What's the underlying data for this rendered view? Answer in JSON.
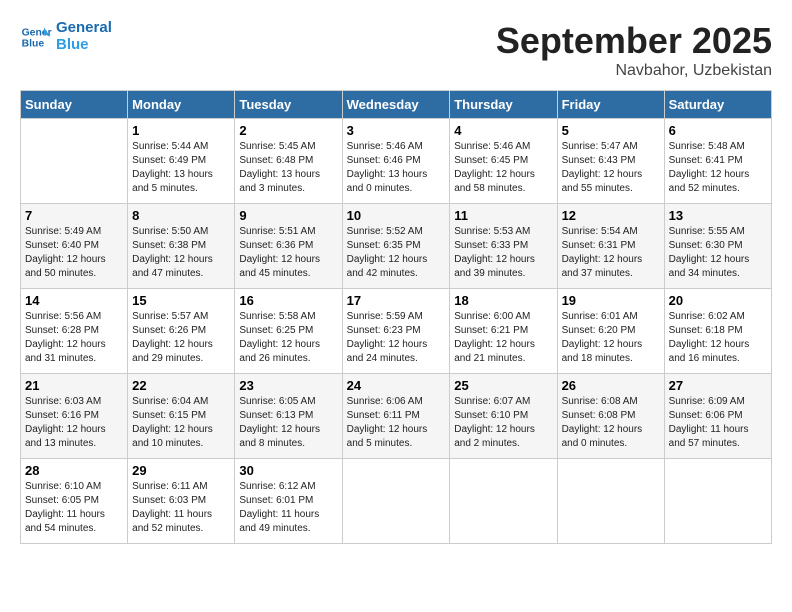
{
  "header": {
    "logo_line1": "General",
    "logo_line2": "Blue",
    "month": "September 2025",
    "location": "Navbahor, Uzbekistan"
  },
  "days_of_week": [
    "Sunday",
    "Monday",
    "Tuesday",
    "Wednesday",
    "Thursday",
    "Friday",
    "Saturday"
  ],
  "weeks": [
    [
      {
        "day": "",
        "sunrise": "",
        "sunset": "",
        "daylight": ""
      },
      {
        "day": "1",
        "sunrise": "Sunrise: 5:44 AM",
        "sunset": "Sunset: 6:49 PM",
        "daylight": "Daylight: 13 hours and 5 minutes."
      },
      {
        "day": "2",
        "sunrise": "Sunrise: 5:45 AM",
        "sunset": "Sunset: 6:48 PM",
        "daylight": "Daylight: 13 hours and 3 minutes."
      },
      {
        "day": "3",
        "sunrise": "Sunrise: 5:46 AM",
        "sunset": "Sunset: 6:46 PM",
        "daylight": "Daylight: 13 hours and 0 minutes."
      },
      {
        "day": "4",
        "sunrise": "Sunrise: 5:46 AM",
        "sunset": "Sunset: 6:45 PM",
        "daylight": "Daylight: 12 hours and 58 minutes."
      },
      {
        "day": "5",
        "sunrise": "Sunrise: 5:47 AM",
        "sunset": "Sunset: 6:43 PM",
        "daylight": "Daylight: 12 hours and 55 minutes."
      },
      {
        "day": "6",
        "sunrise": "Sunrise: 5:48 AM",
        "sunset": "Sunset: 6:41 PM",
        "daylight": "Daylight: 12 hours and 52 minutes."
      }
    ],
    [
      {
        "day": "7",
        "sunrise": "Sunrise: 5:49 AM",
        "sunset": "Sunset: 6:40 PM",
        "daylight": "Daylight: 12 hours and 50 minutes."
      },
      {
        "day": "8",
        "sunrise": "Sunrise: 5:50 AM",
        "sunset": "Sunset: 6:38 PM",
        "daylight": "Daylight: 12 hours and 47 minutes."
      },
      {
        "day": "9",
        "sunrise": "Sunrise: 5:51 AM",
        "sunset": "Sunset: 6:36 PM",
        "daylight": "Daylight: 12 hours and 45 minutes."
      },
      {
        "day": "10",
        "sunrise": "Sunrise: 5:52 AM",
        "sunset": "Sunset: 6:35 PM",
        "daylight": "Daylight: 12 hours and 42 minutes."
      },
      {
        "day": "11",
        "sunrise": "Sunrise: 5:53 AM",
        "sunset": "Sunset: 6:33 PM",
        "daylight": "Daylight: 12 hours and 39 minutes."
      },
      {
        "day": "12",
        "sunrise": "Sunrise: 5:54 AM",
        "sunset": "Sunset: 6:31 PM",
        "daylight": "Daylight: 12 hours and 37 minutes."
      },
      {
        "day": "13",
        "sunrise": "Sunrise: 5:55 AM",
        "sunset": "Sunset: 6:30 PM",
        "daylight": "Daylight: 12 hours and 34 minutes."
      }
    ],
    [
      {
        "day": "14",
        "sunrise": "Sunrise: 5:56 AM",
        "sunset": "Sunset: 6:28 PM",
        "daylight": "Daylight: 12 hours and 31 minutes."
      },
      {
        "day": "15",
        "sunrise": "Sunrise: 5:57 AM",
        "sunset": "Sunset: 6:26 PM",
        "daylight": "Daylight: 12 hours and 29 minutes."
      },
      {
        "day": "16",
        "sunrise": "Sunrise: 5:58 AM",
        "sunset": "Sunset: 6:25 PM",
        "daylight": "Daylight: 12 hours and 26 minutes."
      },
      {
        "day": "17",
        "sunrise": "Sunrise: 5:59 AM",
        "sunset": "Sunset: 6:23 PM",
        "daylight": "Daylight: 12 hours and 24 minutes."
      },
      {
        "day": "18",
        "sunrise": "Sunrise: 6:00 AM",
        "sunset": "Sunset: 6:21 PM",
        "daylight": "Daylight: 12 hours and 21 minutes."
      },
      {
        "day": "19",
        "sunrise": "Sunrise: 6:01 AM",
        "sunset": "Sunset: 6:20 PM",
        "daylight": "Daylight: 12 hours and 18 minutes."
      },
      {
        "day": "20",
        "sunrise": "Sunrise: 6:02 AM",
        "sunset": "Sunset: 6:18 PM",
        "daylight": "Daylight: 12 hours and 16 minutes."
      }
    ],
    [
      {
        "day": "21",
        "sunrise": "Sunrise: 6:03 AM",
        "sunset": "Sunset: 6:16 PM",
        "daylight": "Daylight: 12 hours and 13 minutes."
      },
      {
        "day": "22",
        "sunrise": "Sunrise: 6:04 AM",
        "sunset": "Sunset: 6:15 PM",
        "daylight": "Daylight: 12 hours and 10 minutes."
      },
      {
        "day": "23",
        "sunrise": "Sunrise: 6:05 AM",
        "sunset": "Sunset: 6:13 PM",
        "daylight": "Daylight: 12 hours and 8 minutes."
      },
      {
        "day": "24",
        "sunrise": "Sunrise: 6:06 AM",
        "sunset": "Sunset: 6:11 PM",
        "daylight": "Daylight: 12 hours and 5 minutes."
      },
      {
        "day": "25",
        "sunrise": "Sunrise: 6:07 AM",
        "sunset": "Sunset: 6:10 PM",
        "daylight": "Daylight: 12 hours and 2 minutes."
      },
      {
        "day": "26",
        "sunrise": "Sunrise: 6:08 AM",
        "sunset": "Sunset: 6:08 PM",
        "daylight": "Daylight: 12 hours and 0 minutes."
      },
      {
        "day": "27",
        "sunrise": "Sunrise: 6:09 AM",
        "sunset": "Sunset: 6:06 PM",
        "daylight": "Daylight: 11 hours and 57 minutes."
      }
    ],
    [
      {
        "day": "28",
        "sunrise": "Sunrise: 6:10 AM",
        "sunset": "Sunset: 6:05 PM",
        "daylight": "Daylight: 11 hours and 54 minutes."
      },
      {
        "day": "29",
        "sunrise": "Sunrise: 6:11 AM",
        "sunset": "Sunset: 6:03 PM",
        "daylight": "Daylight: 11 hours and 52 minutes."
      },
      {
        "day": "30",
        "sunrise": "Sunrise: 6:12 AM",
        "sunset": "Sunset: 6:01 PM",
        "daylight": "Daylight: 11 hours and 49 minutes."
      },
      {
        "day": "",
        "sunrise": "",
        "sunset": "",
        "daylight": ""
      },
      {
        "day": "",
        "sunrise": "",
        "sunset": "",
        "daylight": ""
      },
      {
        "day": "",
        "sunrise": "",
        "sunset": "",
        "daylight": ""
      },
      {
        "day": "",
        "sunrise": "",
        "sunset": "",
        "daylight": ""
      }
    ]
  ]
}
